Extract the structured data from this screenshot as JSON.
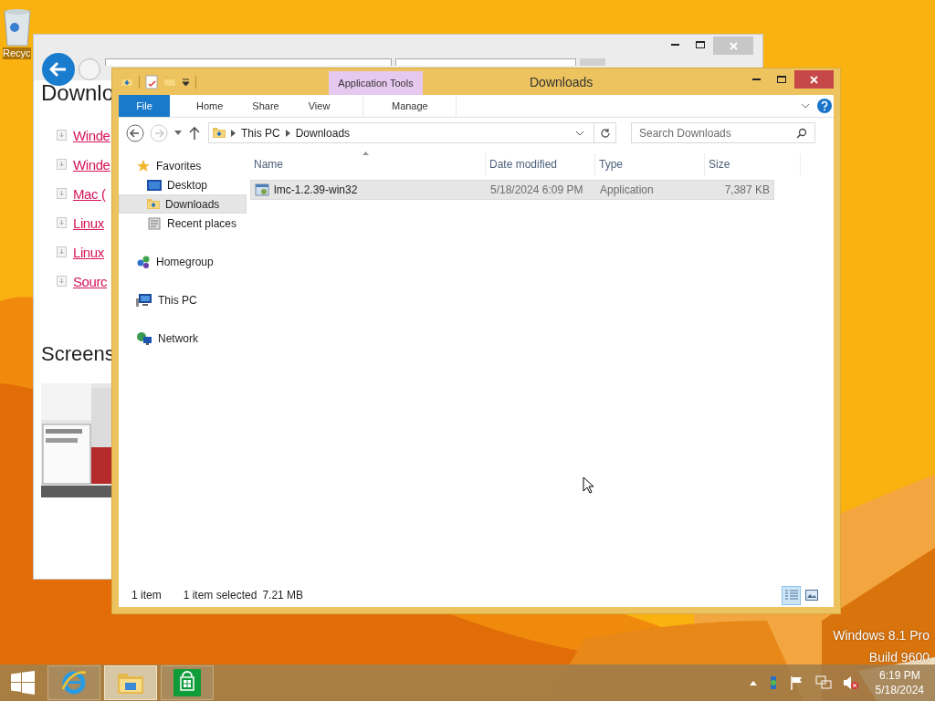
{
  "desktop": {
    "recycle_bin_label": "Recyc",
    "edition": "Windows 8.1 Pro",
    "build": "Build 9600"
  },
  "browser": {
    "heading": "Downlo",
    "links": [
      "Winde",
      "Winde",
      "Mac (",
      "Linux",
      "Linux",
      "Sourc"
    ],
    "section_heading": "Screens"
  },
  "explorer": {
    "title": "Downloads",
    "context_tab": "Application Tools",
    "ribbon_tabs": [
      {
        "label": "File",
        "kind": "file",
        "selected": false
      },
      {
        "label": "Home",
        "kind": "tab",
        "selected": false
      },
      {
        "label": "Share",
        "kind": "tab",
        "selected": false
      },
      {
        "label": "View",
        "kind": "tab",
        "selected": false
      },
      {
        "label": "Manage",
        "kind": "context",
        "selected": false
      }
    ],
    "breadcrumb": [
      "This PC",
      "Downloads"
    ],
    "search": {
      "placeholder": "Search Downloads"
    },
    "nav": [
      {
        "label": "Favorites",
        "kind": "favorites",
        "selected": false,
        "children": [
          {
            "label": "Desktop",
            "kind": "desktop",
            "selected": false
          },
          {
            "label": "Downloads",
            "kind": "downloads",
            "selected": true
          },
          {
            "label": "Recent places",
            "kind": "recent",
            "selected": false
          }
        ]
      },
      {
        "label": "Homegroup",
        "kind": "homegroup",
        "selected": false
      },
      {
        "label": "This PC",
        "kind": "pc",
        "selected": false
      },
      {
        "label": "Network",
        "kind": "network",
        "selected": false
      }
    ],
    "columns": [
      "Name",
      "Date modified",
      "Type",
      "Size"
    ],
    "rows": [
      {
        "name": "lmc-1.2.39-win32",
        "date": "5/18/2024 6:09 PM",
        "type": "Application",
        "size": "7,387 KB",
        "selected": true
      }
    ],
    "status": {
      "count": "1 item",
      "selection": "1 item selected",
      "size": "7.21 MB"
    },
    "views": [
      {
        "kind": "details",
        "selected": true
      },
      {
        "kind": "icons",
        "selected": false
      }
    ]
  },
  "taskbar": {
    "apps": [
      {
        "kind": "ie",
        "selected": false
      },
      {
        "kind": "explorer",
        "selected": true
      },
      {
        "kind": "store",
        "selected": false
      }
    ],
    "time": "6:19 PM",
    "date": "5/18/2024"
  }
}
